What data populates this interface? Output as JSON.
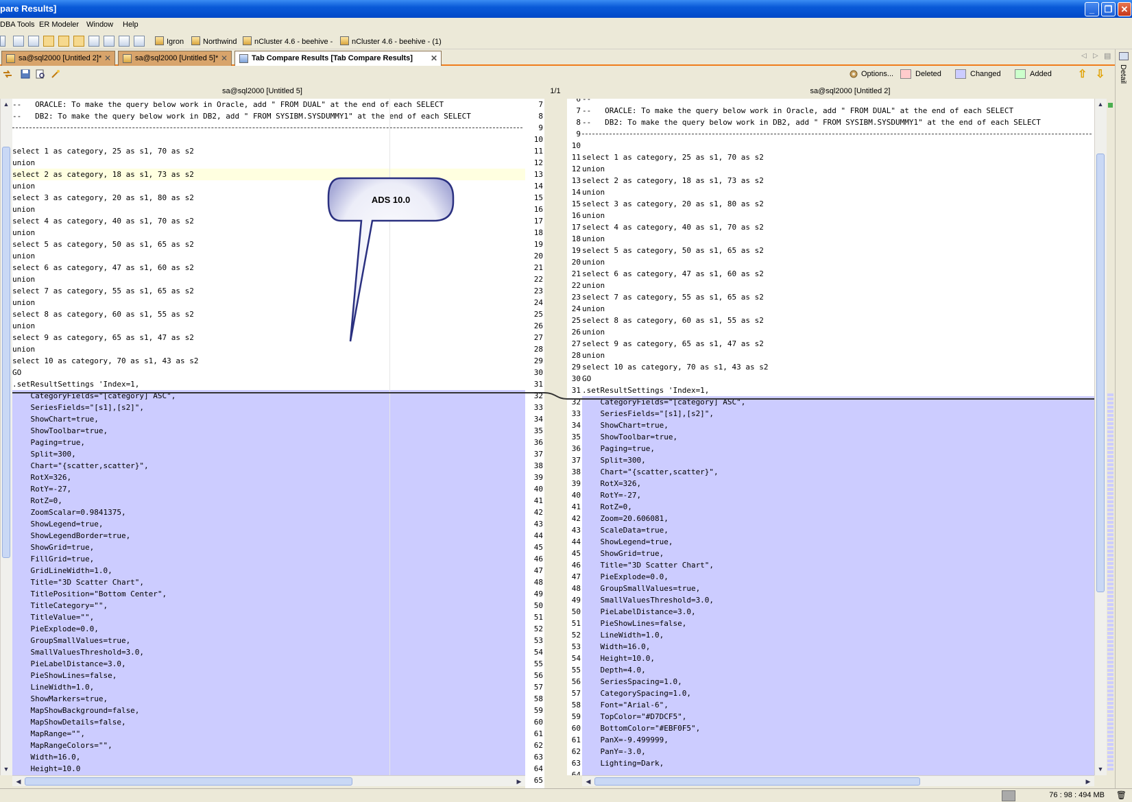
{
  "window": {
    "title": "pare Results]"
  },
  "menu": [
    "DBA Tools",
    "ER Modeler",
    "Window",
    "Help"
  ],
  "connections": [
    "Igron",
    "Northwind",
    "nCluster 4.6 - beehive -",
    "nCluster 4.6 - beehive -  (1)"
  ],
  "tabs": [
    {
      "label": "sa@sql2000 [Untitled 2]*",
      "active": false
    },
    {
      "label": "sa@sql2000 [Untitled 5]*",
      "active": false
    },
    {
      "label": "Tab Compare Results [Tab Compare Results]",
      "active": true
    }
  ],
  "options": {
    "label": "Options...",
    "deleted": "Deleted",
    "changed": "Changed",
    "added": "Added"
  },
  "colors": {
    "deleted": "#ffcccc",
    "changed": "#ccccff",
    "added": "#ccffcc",
    "accent": "#f07c1a"
  },
  "side_label": "Detail",
  "left_header": "sa@sql2000 [Untitled 5]",
  "right_header": "sa@sql2000 [Untitled 2]",
  "diff_count": "1/1",
  "callout": "ADS 10.0",
  "status": {
    "memory": "76 : 98 : 494 MB"
  },
  "left": {
    "lines": [
      {
        "n": "7",
        "t": "--   ORACLE: To make the query below work in Oracle, add \" FROM DUAL\" at the end of each SELECT"
      },
      {
        "n": "8",
        "t": "--   DB2: To make the query below work in DB2, add \" FROM SYSIBM.SYSDUMMY1\" at the end of each SELECT"
      },
      {
        "n": "9",
        "t": "",
        "dashes": true
      },
      {
        "n": "10",
        "t": ""
      },
      {
        "n": "11",
        "t": "select 1 as category, 25 as s1, 70 as s2"
      },
      {
        "n": "12",
        "t": "union"
      },
      {
        "n": "13",
        "t": "select 2 as category, 18 as s1, 73 as s2",
        "hl": true
      },
      {
        "n": "14",
        "t": "union"
      },
      {
        "n": "15",
        "t": "select 3 as category, 20 as s1, 80 as s2"
      },
      {
        "n": "16",
        "t": "union"
      },
      {
        "n": "17",
        "t": "select 4 as category, 40 as s1, 70 as s2"
      },
      {
        "n": "18",
        "t": "union"
      },
      {
        "n": "19",
        "t": "select 5 as category, 50 as s1, 65 as s2"
      },
      {
        "n": "20",
        "t": "union"
      },
      {
        "n": "21",
        "t": "select 6 as category, 47 as s1, 60 as s2"
      },
      {
        "n": "22",
        "t": "union"
      },
      {
        "n": "23",
        "t": "select 7 as category, 55 as s1, 65 as s2"
      },
      {
        "n": "24",
        "t": "union"
      },
      {
        "n": "25",
        "t": "select 8 as category, 60 as s1, 55 as s2"
      },
      {
        "n": "26",
        "t": "union"
      },
      {
        "n": "27",
        "t": "select 9 as category, 65 as s1, 47 as s2"
      },
      {
        "n": "28",
        "t": "union"
      },
      {
        "n": "29",
        "t": "select 10 as category, 70 as s1, 43 as s2"
      },
      {
        "n": "30",
        "t": "GO"
      },
      {
        "n": "31",
        "t": ".setResultSettings 'Index=1,"
      },
      {
        "n": "32",
        "t": "    CategoryFields=\"[category] ASC\",",
        "ch": true
      },
      {
        "n": "33",
        "t": "    SeriesFields=\"[s1],[s2]\",",
        "ch": true
      },
      {
        "n": "34",
        "t": "    ShowChart=true,",
        "ch": true
      },
      {
        "n": "35",
        "t": "    ShowToolbar=true,",
        "ch": true
      },
      {
        "n": "36",
        "t": "    Paging=true,",
        "ch": true
      },
      {
        "n": "37",
        "t": "    Split=300,",
        "ch": true
      },
      {
        "n": "38",
        "t": "    Chart=\"{scatter,scatter}\",",
        "ch": true
      },
      {
        "n": "39",
        "t": "    RotX=326,",
        "ch": true
      },
      {
        "n": "40",
        "t": "    RotY=-27,",
        "ch": true
      },
      {
        "n": "41",
        "t": "    RotZ=0,",
        "ch": true
      },
      {
        "n": "42",
        "t": "    ZoomScalar=0.9841375,",
        "ch": true
      },
      {
        "n": "43",
        "t": "    ShowLegend=true,",
        "ch": true
      },
      {
        "n": "44",
        "t": "    ShowLegendBorder=true,",
        "ch": true
      },
      {
        "n": "45",
        "t": "    ShowGrid=true,",
        "ch": true
      },
      {
        "n": "46",
        "t": "    FillGrid=true,",
        "ch": true
      },
      {
        "n": "47",
        "t": "    GridLineWidth=1.0,",
        "ch": true
      },
      {
        "n": "48",
        "t": "    Title=\"3D Scatter Chart\",",
        "ch": true
      },
      {
        "n": "49",
        "t": "    TitlePosition=\"Bottom Center\",",
        "ch": true
      },
      {
        "n": "50",
        "t": "    TitleCategory=\"\",",
        "ch": true
      },
      {
        "n": "51",
        "t": "    TitleValue=\"\",",
        "ch": true
      },
      {
        "n": "52",
        "t": "    PieExplode=0.0,",
        "ch": true
      },
      {
        "n": "53",
        "t": "    GroupSmallValues=true,",
        "ch": true
      },
      {
        "n": "54",
        "t": "    SmallValuesThreshold=3.0,",
        "ch": true
      },
      {
        "n": "55",
        "t": "    PieLabelDistance=3.0,",
        "ch": true
      },
      {
        "n": "56",
        "t": "    PieShowLines=false,",
        "ch": true
      },
      {
        "n": "57",
        "t": "    LineWidth=1.0,",
        "ch": true
      },
      {
        "n": "58",
        "t": "    ShowMarkers=true,",
        "ch": true
      },
      {
        "n": "59",
        "t": "    MapShowBackground=false,",
        "ch": true
      },
      {
        "n": "60",
        "t": "    MapShowDetails=false,",
        "ch": true
      },
      {
        "n": "61",
        "t": "    MapRange=\"\",",
        "ch": true
      },
      {
        "n": "62",
        "t": "    MapRangeColors=\"\",",
        "ch": true
      },
      {
        "n": "63",
        "t": "    Width=16.0,",
        "ch": true
      },
      {
        "n": "64",
        "t": "    Height=10.0",
        "ch": true
      },
      {
        "n": "65",
        "t": "",
        "ch": true
      }
    ]
  },
  "right": {
    "lines": [
      {
        "n": "6",
        "t": "--"
      },
      {
        "n": "7",
        "t": "--   ORACLE: To make the query below work in Oracle, add \" FROM DUAL\" at the end of each SELECT"
      },
      {
        "n": "8",
        "t": "--   DB2: To make the query below work in DB2, add \" FROM SYSIBM.SYSDUMMY1\" at the end of each SELECT"
      },
      {
        "n": "9",
        "t": "",
        "dashes": true
      },
      {
        "n": "10",
        "t": ""
      },
      {
        "n": "11",
        "t": "select 1 as category, 25 as s1, 70 as s2"
      },
      {
        "n": "12",
        "t": "union"
      },
      {
        "n": "13",
        "t": "select 2 as category, 18 as s1, 73 as s2"
      },
      {
        "n": "14",
        "t": "union"
      },
      {
        "n": "15",
        "t": "select 3 as category, 20 as s1, 80 as s2"
      },
      {
        "n": "16",
        "t": "union"
      },
      {
        "n": "17",
        "t": "select 4 as category, 40 as s1, 70 as s2"
      },
      {
        "n": "18",
        "t": "union"
      },
      {
        "n": "19",
        "t": "select 5 as category, 50 as s1, 65 as s2"
      },
      {
        "n": "20",
        "t": "union"
      },
      {
        "n": "21",
        "t": "select 6 as category, 47 as s1, 60 as s2"
      },
      {
        "n": "22",
        "t": "union"
      },
      {
        "n": "23",
        "t": "select 7 as category, 55 as s1, 65 as s2"
      },
      {
        "n": "24",
        "t": "union"
      },
      {
        "n": "25",
        "t": "select 8 as category, 60 as s1, 55 as s2"
      },
      {
        "n": "26",
        "t": "union"
      },
      {
        "n": "27",
        "t": "select 9 as category, 65 as s1, 47 as s2"
      },
      {
        "n": "28",
        "t": "union"
      },
      {
        "n": "29",
        "t": "select 10 as category, 70 as s1, 43 as s2"
      },
      {
        "n": "30",
        "t": "GO"
      },
      {
        "n": "31",
        "t": ".setResultSettings 'Index=1,"
      },
      {
        "n": "32",
        "t": "    CategoryFields=\"[category] ASC\",",
        "ch": true
      },
      {
        "n": "33",
        "t": "    SeriesFields=\"[s1],[s2]\",",
        "ch": true
      },
      {
        "n": "34",
        "t": "    ShowChart=true,",
        "ch": true
      },
      {
        "n": "35",
        "t": "    ShowToolbar=true,",
        "ch": true
      },
      {
        "n": "36",
        "t": "    Paging=true,",
        "ch": true
      },
      {
        "n": "37",
        "t": "    Split=300,",
        "ch": true
      },
      {
        "n": "38",
        "t": "    Chart=\"{scatter,scatter}\",",
        "ch": true
      },
      {
        "n": "39",
        "t": "    RotX=326,",
        "ch": true
      },
      {
        "n": "40",
        "t": "    RotY=-27,",
        "ch": true
      },
      {
        "n": "41",
        "t": "    RotZ=0,",
        "ch": true
      },
      {
        "n": "42",
        "t": "    Zoom=20.606081,",
        "ch": true
      },
      {
        "n": "43",
        "t": "    ScaleData=true,",
        "ch": true
      },
      {
        "n": "44",
        "t": "    ShowLegend=true,",
        "ch": true
      },
      {
        "n": "45",
        "t": "    ShowGrid=true,",
        "ch": true
      },
      {
        "n": "46",
        "t": "    Title=\"3D Scatter Chart\",",
        "ch": true
      },
      {
        "n": "47",
        "t": "    PieExplode=0.0,",
        "ch": true
      },
      {
        "n": "48",
        "t": "    GroupSmallValues=true,",
        "ch": true
      },
      {
        "n": "49",
        "t": "    SmallValuesThreshold=3.0,",
        "ch": true
      },
      {
        "n": "50",
        "t": "    PieLabelDistance=3.0,",
        "ch": true
      },
      {
        "n": "51",
        "t": "    PieShowLines=false,",
        "ch": true
      },
      {
        "n": "52",
        "t": "    LineWidth=1.0,",
        "ch": true
      },
      {
        "n": "53",
        "t": "    Width=16.0,",
        "ch": true
      },
      {
        "n": "54",
        "t": "    Height=10.0,",
        "ch": true
      },
      {
        "n": "55",
        "t": "    Depth=4.0,",
        "ch": true
      },
      {
        "n": "56",
        "t": "    SeriesSpacing=1.0,",
        "ch": true
      },
      {
        "n": "57",
        "t": "    CategorySpacing=1.0,",
        "ch": true
      },
      {
        "n": "58",
        "t": "    Font=\"Arial-6\",",
        "ch": true
      },
      {
        "n": "59",
        "t": "    TopColor=\"#D7DCF5\",",
        "ch": true
      },
      {
        "n": "60",
        "t": "    BottomColor=\"#EBF0F5\",",
        "ch": true
      },
      {
        "n": "61",
        "t": "    PanX=-9.499999,",
        "ch": true
      },
      {
        "n": "62",
        "t": "    PanY=-3.0,",
        "ch": true
      },
      {
        "n": "63",
        "t": "    Lighting=Dark,",
        "ch": true
      },
      {
        "n": "64",
        "t": "",
        "ch": true
      }
    ]
  }
}
